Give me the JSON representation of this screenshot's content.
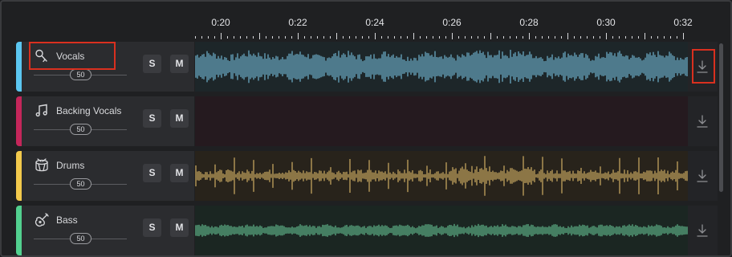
{
  "timeline": {
    "labels": [
      "0:20",
      "0:22",
      "0:24",
      "0:26",
      "0:28",
      "0:30",
      "0:32"
    ]
  },
  "tracks": [
    {
      "name": "Vocals",
      "icon": "microphone-icon",
      "volume": "50",
      "solo_label": "S",
      "mute_label": "M",
      "color": "#5bc6f0",
      "wave_color": "#7fcfee",
      "lane_bg": "#1d2629",
      "has_audio": true
    },
    {
      "name": "Backing Vocals",
      "icon": "music-note-icon",
      "volume": "50",
      "solo_label": "S",
      "mute_label": "M",
      "color": "#c4265a",
      "wave_color": "#c4265a",
      "lane_bg": "#251a1f",
      "has_audio": false
    },
    {
      "name": "Drums",
      "icon": "drum-icon",
      "volume": "50",
      "solo_label": "S",
      "mute_label": "M",
      "color": "#f2c94c",
      "wave_color": "#efc870",
      "lane_bg": "#28231b",
      "has_audio": true
    },
    {
      "name": "Bass",
      "icon": "guitar-icon",
      "volume": "50",
      "solo_label": "S",
      "mute_label": "M",
      "color": "#52d08f",
      "wave_color": "#6fd6a2",
      "lane_bg": "#1b2622",
      "has_audio": true
    }
  ]
}
